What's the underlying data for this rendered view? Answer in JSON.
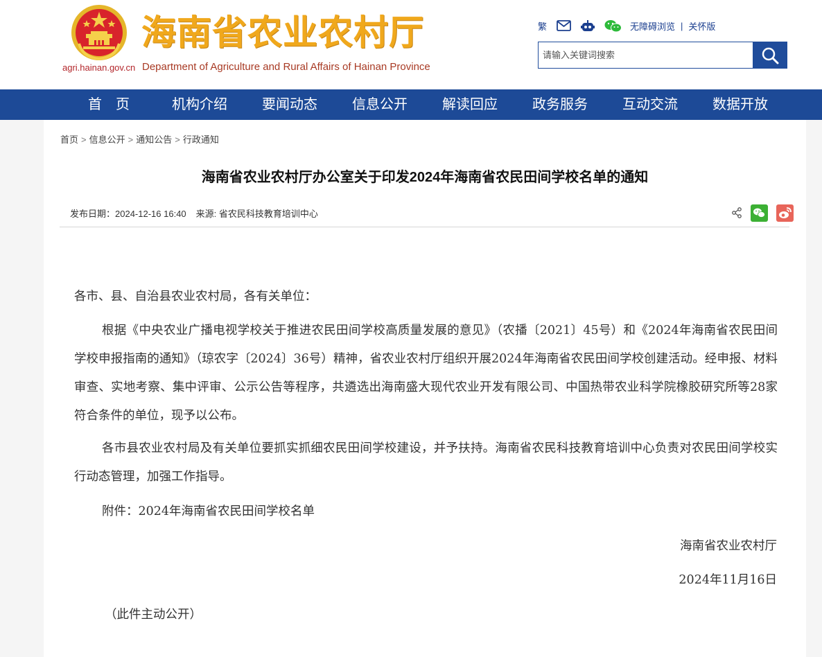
{
  "header": {
    "title": "海南省农业农村厅",
    "domain": "agri.hainan.gov.cn",
    "subtitle": "Department of Agriculture and Rural Affairs of Hainan Province",
    "links": {
      "traditional": "繁",
      "mail_icon": "envelope-icon",
      "robot_icon": "robot-icon",
      "wechat_icon": "wechat-icon",
      "accessibility": "无障碍浏览",
      "separator": "|",
      "elder": "关怀版"
    },
    "search": {
      "placeholder": "请输入关键词搜索",
      "button_icon": "search-icon"
    }
  },
  "nav": {
    "items": [
      {
        "label": "首　页"
      },
      {
        "label": "机构介绍"
      },
      {
        "label": "要闻动态"
      },
      {
        "label": "信息公开"
      },
      {
        "label": "解读回应"
      },
      {
        "label": "政务服务"
      },
      {
        "label": "互动交流"
      },
      {
        "label": "数据开放"
      }
    ]
  },
  "breadcrumb": {
    "items": [
      "首页",
      "信息公开",
      "通知公告",
      "行政通知"
    ],
    "separator": ">"
  },
  "article": {
    "title": "海南省农业农村厅办公室关于印发2024年海南省农民田间学校名单的通知",
    "date_label": "发布日期：",
    "date": "2024-12-16 16:40",
    "source_label": "来源: ",
    "source": "省农民科技教育培训中心",
    "salutation": "各市、县、自治县农业农村局，各有关单位：",
    "paragraphs": [
      "根据《中央农业广播电视学校关于推进农民田间学校高质量发展的意见》（农播〔2021〕45号）和《2024年海南省农民田间学校申报指南的通知》（琼农字〔2024〕36号）精神，省农业农村厅组织开展2024年海南省农民田间学校创建活动。经申报、材料审查、实地考察、集中评审、公示公告等程序，共遴选出海南盛大现代农业开发有限公司、中国热带农业科学院橡胶研究所等28家符合条件的单位，现予以公布。",
      "各市县农业农村局及有关单位要抓实抓细农民田间学校建设，并予扶持。海南省农民科技教育培训中心负责对农民田间学校实行动态管理，加强工作指导。",
      "附件：2024年海南省农民田间学校名单"
    ],
    "signature": "海南省农业农村厅",
    "sign_date": "2024年11月16日",
    "note": "（此件主动公开）"
  },
  "share": {
    "icons": [
      "share-icon",
      "wechat-share-icon",
      "weibo-share-icon"
    ]
  },
  "colors": {
    "nav_blue": "#1d4a97",
    "title_gold": "#f0a81c",
    "emblem_red": "#d8242b"
  }
}
